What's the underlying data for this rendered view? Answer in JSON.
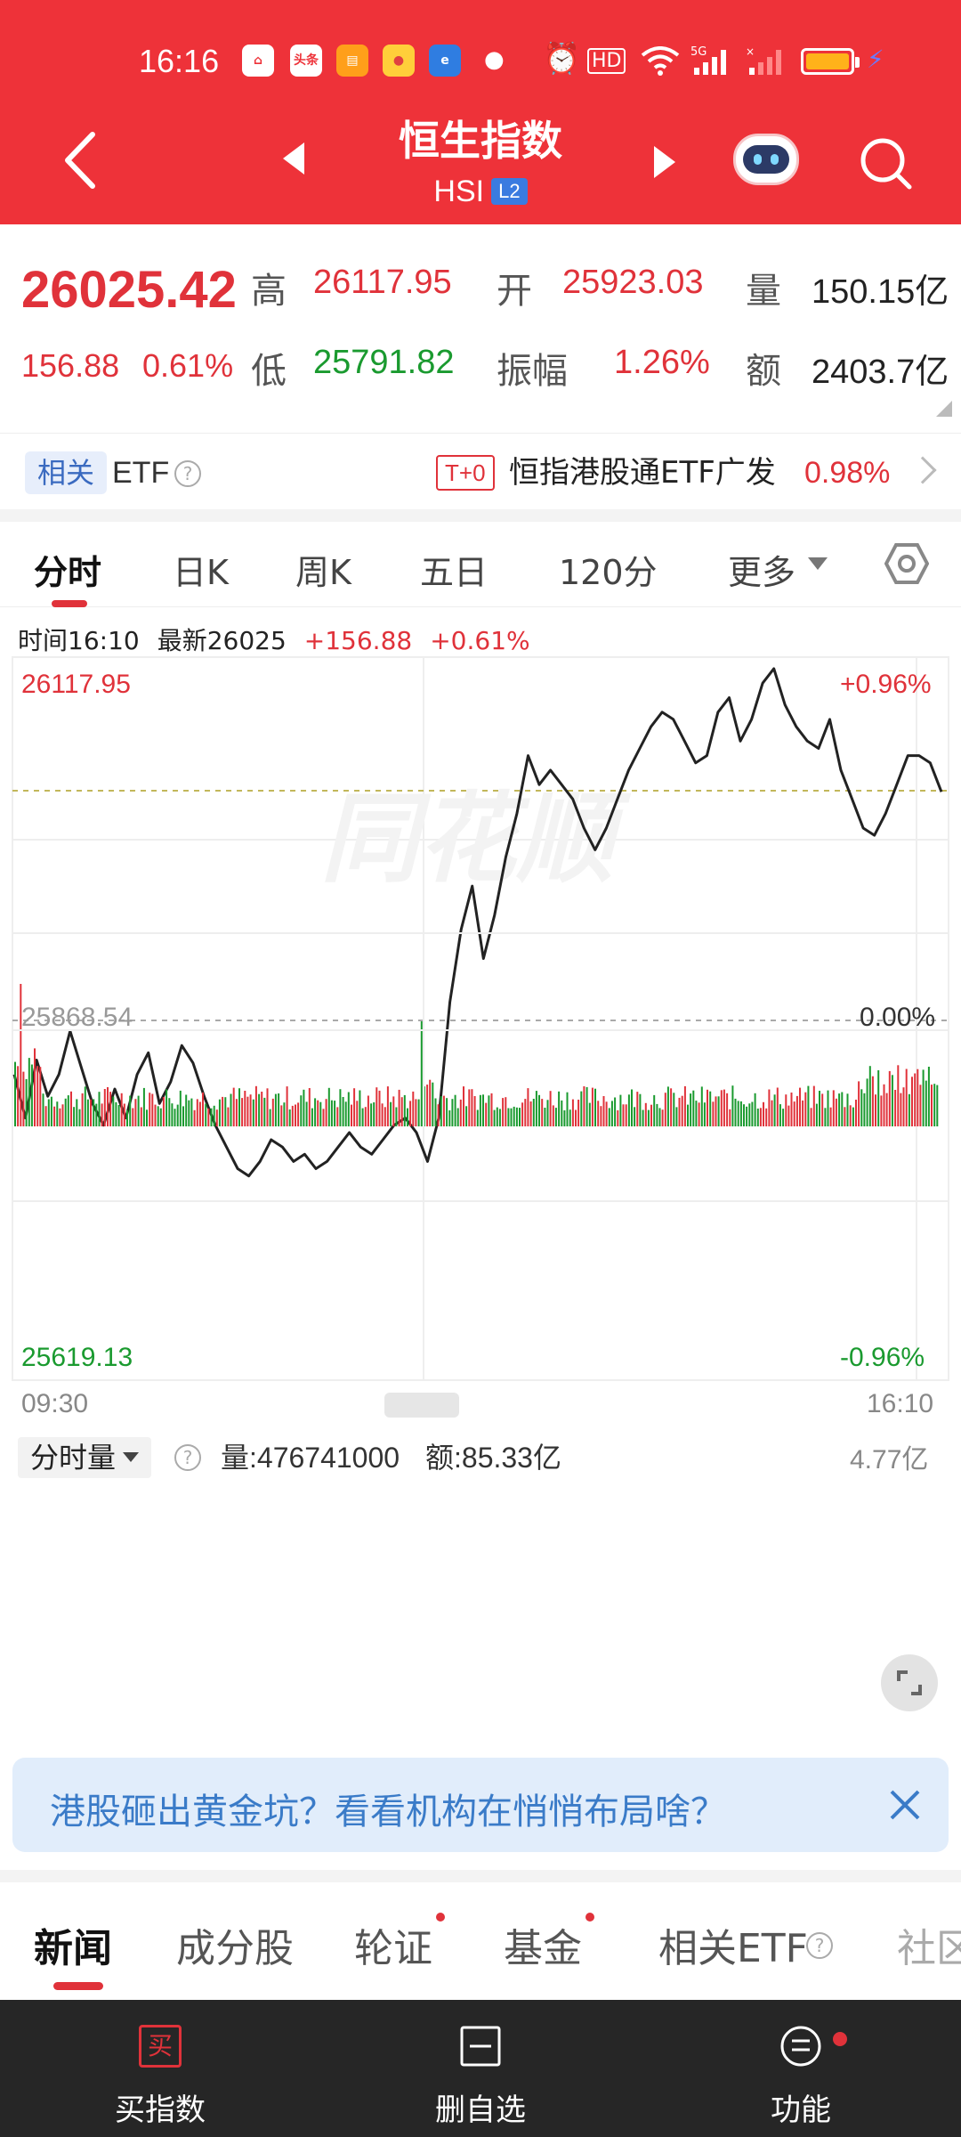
{
  "status_bar": {
    "time": "16:16",
    "notification_icons": [
      "头条"
    ]
  },
  "header": {
    "title": "恒生指数",
    "code": "HSI",
    "level_badge": "L2"
  },
  "quote": {
    "last_price": "26025.42",
    "change_abs": "156.88",
    "change_pct": "0.61%",
    "high_label": "高",
    "high_value": "26117.95",
    "low_label": "低",
    "low_value": "25791.82",
    "open_label": "开",
    "open_value": "25923.03",
    "amplitude_label": "振幅",
    "amplitude_value": "1.26%",
    "volume_label": "量",
    "volume_value": "150.15亿",
    "turnover_label": "额",
    "turnover_value": "2403.7亿"
  },
  "etf_row": {
    "tag": "相关",
    "label": "ETF",
    "t0_badge": "T+0",
    "name": "恒指港股通ETF广发",
    "change_pct": "0.98%"
  },
  "period_tabs": [
    "分时",
    "日K",
    "周K",
    "五日",
    "120分",
    "更多"
  ],
  "info_line": {
    "time": "时间16:10",
    "latest": "最新26025",
    "change_abs": "+156.88",
    "change_pct": "+0.61%"
  },
  "colors": {
    "header_red": "#ee3239",
    "up_red": "#e0323a",
    "down_green": "#1a9a2f",
    "line": "#222222"
  },
  "chart_data": [
    {
      "type": "line",
      "title": "",
      "xlabel": "",
      "ylabel": "",
      "x_start": "09:30",
      "x_end": "16:10",
      "ylim": [
        25619.13,
        26117.95
      ],
      "y_top_label": "26117.95",
      "y_mid_label": "25868.54",
      "y_bottom_label": "25619.13",
      "pct_top_label": "+0.96%",
      "pct_mid_label": "0.00%",
      "pct_bottom_label": "-0.96%",
      "reference_price": 25868.54,
      "latest_price": 26025,
      "series": [
        {
          "values": [
            25830,
            25800,
            25840,
            25815,
            25830,
            25860,
            25835,
            25810,
            25795,
            25820,
            25800,
            25830,
            25845,
            25810,
            25825,
            25850,
            25838,
            25815,
            25795,
            25780,
            25765,
            25760,
            25770,
            25785,
            25780,
            25770,
            25775,
            25765,
            25770,
            25780,
            25790,
            25780,
            25775,
            25785,
            25795,
            25800,
            25790,
            25770,
            25800,
            25880,
            25930,
            25960,
            25910,
            25940,
            25980,
            26010,
            26050,
            26030,
            26040,
            26030,
            26020,
            26000,
            25985,
            26000,
            26020,
            26040,
            26055,
            26070,
            26080,
            26075,
            26060,
            26045,
            26050,
            26080,
            26090,
            26060,
            26075,
            26100,
            26110,
            26085,
            26070,
            26060,
            26055,
            26075,
            26040,
            26020,
            26000,
            25995,
            26010,
            26030,
            26050,
            26050,
            26045,
            26025
          ]
        }
      ]
    },
    {
      "type": "bar",
      "title": "",
      "label": "分时量",
      "volume_text": "量:476741000",
      "turnover_text": "额:85.33亿",
      "ymax_label": "4.77亿"
    }
  ],
  "promo": {
    "text": "港股砸出黄金坑？看看机构在悄悄布局啥？"
  },
  "news_tabs": [
    "新闻",
    "成分股",
    "轮证",
    "基金",
    "相关ETF",
    "社区"
  ],
  "bottom_bar": {
    "buy": "买指数",
    "remove": "删自选",
    "functions": "功能"
  }
}
